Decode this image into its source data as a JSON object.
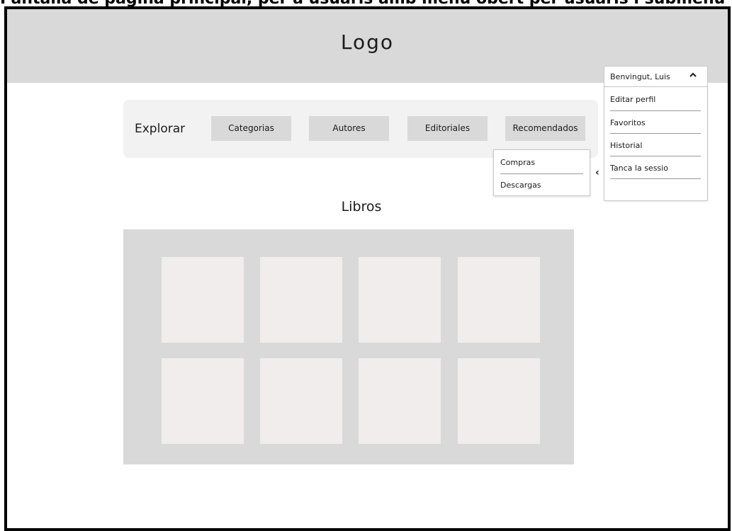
{
  "caption": "Pantalla de pàgina principal, per a usuaris amb menú obert per usuaris i submenú",
  "header": {
    "logo": "Logo"
  },
  "explore": {
    "label": "Explorar",
    "buttons": [
      "Categorias",
      "Autores",
      "Editoriales",
      "Recomendados"
    ]
  },
  "submenu": {
    "items": [
      "Compras",
      "Descargas"
    ]
  },
  "user": {
    "greeting": "Benvingut, Luis",
    "menu": [
      "Editar perfil",
      "Favoritos",
      "Historial",
      "Tanca la sessio"
    ]
  },
  "books": {
    "title": "Libros",
    "count": 8
  },
  "icons": {
    "user_toggle": "chevron-up-icon",
    "submenu_toggle": "chevron-left-icon"
  },
  "colors": {
    "header_bg": "#d9d9d9",
    "explore_bg": "#f2f2f2",
    "button_bg": "#d9d9d9",
    "grid_bg": "#d9d9d9",
    "card_bg": "#f1edec"
  }
}
